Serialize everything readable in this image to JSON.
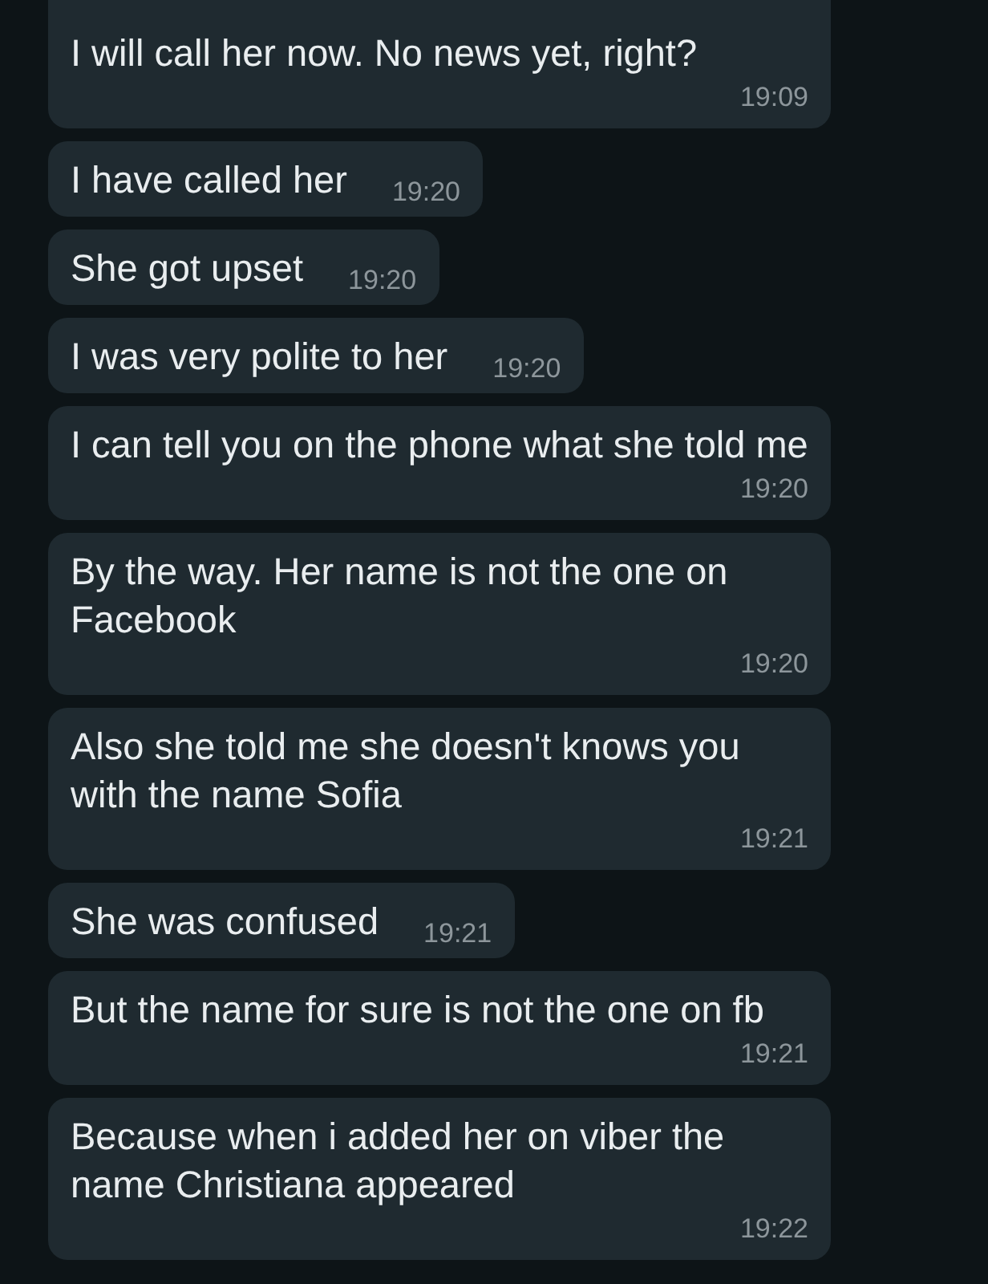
{
  "messages": [
    {
      "text": "I will call her now. No news yet, right?",
      "time": "19:09",
      "kind": "long"
    },
    {
      "text": "I have called her",
      "time": "19:20",
      "kind": "short"
    },
    {
      "text": "She got upset",
      "time": "19:20",
      "kind": "short"
    },
    {
      "text": "I was very polite to her",
      "time": "19:20",
      "kind": "short"
    },
    {
      "text": "I can tell you on the phone what she told me",
      "time": "19:20",
      "kind": "long"
    },
    {
      "text": "By the way. Her name is not the one on Facebook",
      "time": "19:20",
      "kind": "long"
    },
    {
      "text": "Also she told me she doesn't knows you with the name Sofia",
      "time": "19:21",
      "kind": "long"
    },
    {
      "text": "She was confused",
      "time": "19:21",
      "kind": "short"
    },
    {
      "text": "But the name for sure is not the one on fb",
      "time": "19:21",
      "kind": "long"
    },
    {
      "text": "Because when i added her on viber the name Christiana appeared",
      "time": "19:22",
      "kind": "long"
    }
  ]
}
